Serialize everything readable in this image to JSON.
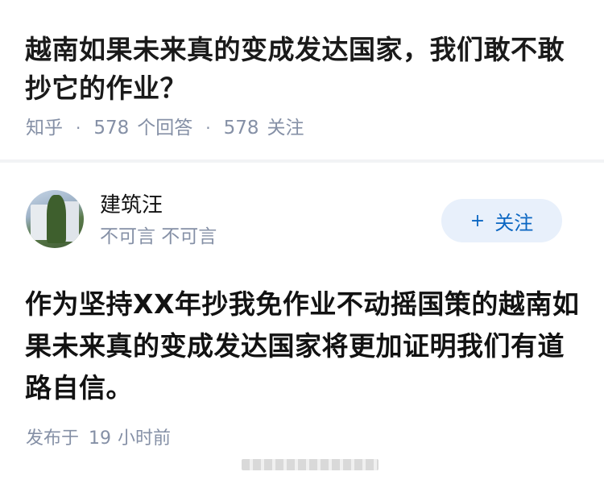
{
  "question": {
    "title": "越南如果未来真的变成发达国家，我们敢不敢抄它的作业？",
    "source": "知乎",
    "separator": "·",
    "answer_count": "578",
    "answer_label": "个回答",
    "follow_count": "578",
    "follow_label": "关注"
  },
  "answer": {
    "author_name": "建筑汪",
    "author_bio": "不可言 不可言",
    "follow_button": "关注",
    "follow_plus": "+",
    "content": "作为坚持XX年抄我免作业不动摇国策的越南如果未来真的变成发达国家将更加证明我们有道路自信。",
    "published_label": "发布于",
    "published_num": "19",
    "published_unit": "小时前"
  }
}
